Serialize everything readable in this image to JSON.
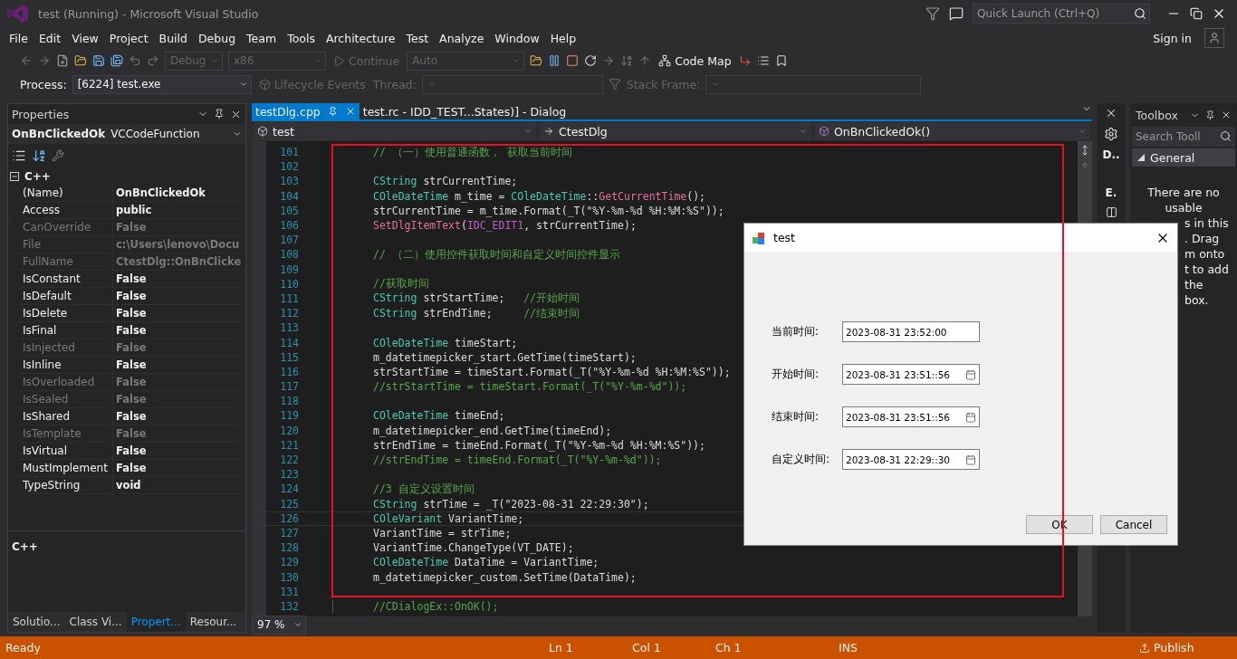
{
  "window": {
    "title": "test (Running) - Microsoft Visual Studio",
    "quick_launch": {
      "placeholder": "Quick Launch (Ctrl+Q)"
    }
  },
  "menu": [
    "File",
    "Edit",
    "View",
    "Project",
    "Build",
    "Debug",
    "Team",
    "Tools",
    "Architecture",
    "Test",
    "Analyze",
    "Window",
    "Help"
  ],
  "sign_in": "Sign in",
  "toolbar": {
    "configuration": {
      "value": "Debug",
      "disabled": true
    },
    "platform": {
      "value": "x86",
      "disabled": true
    },
    "continue": {
      "label": "Continue",
      "disabled": true
    },
    "engine": {
      "value": "Auto",
      "disabled": true
    },
    "code_map": "Code Map"
  },
  "debug_bar": {
    "process_label": "Process:",
    "process": "[6224] test.exe",
    "lifecycle": "Lifecycle Events",
    "thread_label": "Thread:",
    "stack_label": "Stack Frame:"
  },
  "properties": {
    "title": "Properties",
    "object_name": "OnBnClickedOk",
    "object_type": "VCCodeFunction",
    "category": {
      "name": "C++",
      "expanded": true
    },
    "rows": [
      {
        "name": "(Name)",
        "value": "OnBnClickedOk",
        "disabled": false
      },
      {
        "name": "Access",
        "value": "public",
        "disabled": false
      },
      {
        "name": "CanOverride",
        "value": "False",
        "disabled": true
      },
      {
        "name": "File",
        "value": "c:\\Users\\lenovo\\Docu",
        "disabled": true
      },
      {
        "name": "FullName",
        "value": "CtestDlg::OnBnClicke",
        "disabled": true
      },
      {
        "name": "IsConstant",
        "value": "False",
        "disabled": false
      },
      {
        "name": "IsDefault",
        "value": "False",
        "disabled": false
      },
      {
        "name": "IsDelete",
        "value": "False",
        "disabled": false
      },
      {
        "name": "IsFinal",
        "value": "False",
        "disabled": false
      },
      {
        "name": "IsInjected",
        "value": "False",
        "disabled": true
      },
      {
        "name": "IsInline",
        "value": "False",
        "disabled": false
      },
      {
        "name": "IsOverloaded",
        "value": "False",
        "disabled": true
      },
      {
        "name": "IsSealed",
        "value": "False",
        "disabled": true
      },
      {
        "name": "IsShared",
        "value": "False",
        "disabled": false
      },
      {
        "name": "IsTemplate",
        "value": "False",
        "disabled": true
      },
      {
        "name": "IsVirtual",
        "value": "False",
        "disabled": false
      },
      {
        "name": "MustImplement",
        "value": "False",
        "disabled": false
      },
      {
        "name": "TypeString",
        "value": "void",
        "disabled": false
      }
    ],
    "description": "C++",
    "tabs": [
      {
        "label": "Solutio...",
        "selected": false
      },
      {
        "label": "Class Vi...",
        "selected": false
      },
      {
        "label": "Propert...",
        "selected": true
      },
      {
        "label": "Resour...",
        "selected": false
      }
    ]
  },
  "editor": {
    "tabs": [
      {
        "label": "testDlg.cpp",
        "selected": true
      },
      {
        "label": "test.rc - IDD_TEST...States)] - Dialog",
        "selected": false
      }
    ],
    "nav": {
      "project": "test",
      "class": "CtestDlg",
      "member": "OnBnClickedOk()"
    },
    "zoom": "97 %",
    "lines": [
      {
        "number": "101",
        "current": false,
        "segments": [
          {
            "kind": "comment",
            "text": "// （一）使用普通函数， 获取当前时间"
          }
        ]
      },
      {
        "number": "102",
        "current": false
      },
      {
        "number": "103",
        "current": false,
        "segments": [
          {
            "kind": "type",
            "text": "CString"
          },
          {
            "kind": "plain",
            "text": " strCurrentTime;"
          }
        ]
      },
      {
        "number": "104",
        "current": false,
        "segments": [
          {
            "kind": "type",
            "text": "COleDateTime"
          },
          {
            "kind": "plain",
            "text": " m_time = "
          },
          {
            "kind": "type",
            "text": "COleDateTime"
          },
          {
            "kind": "plain",
            "text": "::"
          },
          {
            "kind": "func",
            "text": "GetCurrentTime"
          },
          {
            "kind": "plain",
            "text": "();"
          }
        ]
      },
      {
        "number": "105",
        "current": false,
        "segments": [
          {
            "kind": "plain",
            "text": "strCurrentTime = m_time.Format(_T(\"%Y-%m-%d %H:%M:%S\"));"
          }
        ]
      },
      {
        "number": "106",
        "current": false,
        "segments": [
          {
            "kind": "func",
            "text": "SetDlgItemText"
          },
          {
            "kind": "plain",
            "text": "("
          },
          {
            "kind": "macro",
            "text": "IDC_EDIT1"
          },
          {
            "kind": "plain",
            "text": ", strCurrentTime);"
          }
        ]
      },
      {
        "number": "107",
        "current": false
      },
      {
        "number": "108",
        "current": false,
        "segments": [
          {
            "kind": "comment",
            "text": "// （二）使用控件获取时间和自定义时间控件显示"
          }
        ]
      },
      {
        "number": "109",
        "current": false
      },
      {
        "number": "110",
        "current": false,
        "segments": [
          {
            "kind": "comment",
            "text": "//获取时间"
          }
        ]
      },
      {
        "number": "111",
        "current": false,
        "segments": [
          {
            "kind": "type",
            "text": "CString"
          },
          {
            "kind": "plain",
            "text": " strStartTime;   "
          },
          {
            "kind": "comment",
            "text": "//开始时间"
          }
        ]
      },
      {
        "number": "112",
        "current": false,
        "segments": [
          {
            "kind": "type",
            "text": "CString"
          },
          {
            "kind": "plain",
            "text": " strEndTime;     "
          },
          {
            "kind": "comment",
            "text": "//结束时间"
          }
        ]
      },
      {
        "number": "113",
        "current": false
      },
      {
        "number": "114",
        "current": false,
        "segments": [
          {
            "kind": "type",
            "text": "COleDateTime"
          },
          {
            "kind": "plain",
            "text": " timeStart;"
          }
        ]
      },
      {
        "number": "115",
        "current": false,
        "segments": [
          {
            "kind": "plain",
            "text": "m_datetimepicker_start.GetTime(timeStart);"
          }
        ]
      },
      {
        "number": "116",
        "current": false,
        "segments": [
          {
            "kind": "plain",
            "text": "strStartTime = timeStart.Format(_T(\"%Y-%m-%d %H:%M:%S\"));"
          }
        ]
      },
      {
        "number": "117",
        "current": false,
        "segments": [
          {
            "kind": "comment",
            "text": "//strStartTime = timeStart.Format(_T(\"%Y-%m-%d\"));"
          }
        ]
      },
      {
        "number": "118",
        "current": false
      },
      {
        "number": "119",
        "current": false,
        "segments": [
          {
            "kind": "type",
            "text": "COleDateTime"
          },
          {
            "kind": "plain",
            "text": " timeEnd;"
          }
        ]
      },
      {
        "number": "120",
        "current": false,
        "segments": [
          {
            "kind": "plain",
            "text": "m_datetimepicker_end.GetTime(timeEnd);"
          }
        ]
      },
      {
        "number": "121",
        "current": false,
        "segments": [
          {
            "kind": "plain",
            "text": "strEndTime = timeEnd.Format(_T(\"%Y-%m-%d %H:%M:%S\"));"
          }
        ]
      },
      {
        "number": "122",
        "current": false,
        "segments": [
          {
            "kind": "comment",
            "text": "//strEndTime = timeEnd.Format(_T(\"%Y-%m-%d\"));"
          }
        ]
      },
      {
        "number": "123",
        "current": false
      },
      {
        "number": "124",
        "current": false,
        "segments": [
          {
            "kind": "comment",
            "text": "//3 自定义设置时间"
          }
        ]
      },
      {
        "number": "125",
        "current": false,
        "segments": [
          {
            "kind": "type",
            "text": "CString"
          },
          {
            "kind": "plain",
            "text": " strTime = _T(\"2023-08-31 22:29:30\");"
          }
        ]
      },
      {
        "number": "126",
        "current": true,
        "segments": [
          {
            "kind": "type",
            "text": "COleVariant"
          },
          {
            "kind": "plain",
            "text": " VariantTime;"
          }
        ]
      },
      {
        "number": "127",
        "current": false,
        "segments": [
          {
            "kind": "plain",
            "text": "VariantTime = strTime;"
          }
        ]
      },
      {
        "number": "128",
        "current": false,
        "segments": [
          {
            "kind": "plain",
            "text": "VariantTime.ChangeType(VT_DATE);"
          }
        ]
      },
      {
        "number": "129",
        "current": false,
        "segments": [
          {
            "kind": "type",
            "text": "COleDateTime"
          },
          {
            "kind": "plain",
            "text": " DataTime = VariantTime;"
          }
        ]
      },
      {
        "number": "130",
        "current": false,
        "segments": [
          {
            "kind": "plain",
            "text": "m_datetimepicker_custom.SetTime(DataTime);"
          }
        ]
      },
      {
        "number": "131",
        "current": false
      },
      {
        "number": "132",
        "current": false,
        "segments": [
          {
            "kind": "comment",
            "text": "//CDialogEx::OnOK();"
          }
        ]
      }
    ]
  },
  "side_strip": {
    "top": "D..",
    "section": "E."
  },
  "toolbox": {
    "title": "Toolbox",
    "search": {
      "placeholder": "Search Tooll"
    },
    "group": {
      "name": "General",
      "expanded": true
    },
    "message": [
      {
        "text": "There are no",
        "clipped": false
      },
      {
        "text": "usable",
        "clipped": false
      },
      {
        "text": "s in this",
        "clipped": true
      },
      {
        "text": ". Drag",
        "clipped": true
      },
      {
        "text": "m onto",
        "clipped": true
      },
      {
        "text": "t to add",
        "clipped": true
      },
      {
        "text": "the",
        "clipped": true
      },
      {
        "text": "box.",
        "clipped": true
      }
    ]
  },
  "dialog": {
    "title": "test",
    "fields": [
      {
        "label": "当前时间:",
        "value": "2023-08-31 23:52:00",
        "kind": "text"
      },
      {
        "label": "开始时间:",
        "value": "2023-08-31 23:51::56",
        "kind": "datetime"
      },
      {
        "label": "结束时间:",
        "value": "2023-08-31 23:51::56",
        "kind": "datetime"
      },
      {
        "label": "自定义时间:",
        "value": "2023-08-31 22:29::30",
        "kind": "datetime"
      }
    ],
    "buttons": [
      "OK",
      "Cancel"
    ]
  },
  "status_bar": {
    "state": "Ready",
    "line": "Ln 1",
    "column": "Col 1",
    "char": "Ch 1",
    "mode": "INS",
    "publish": "Publish"
  }
}
